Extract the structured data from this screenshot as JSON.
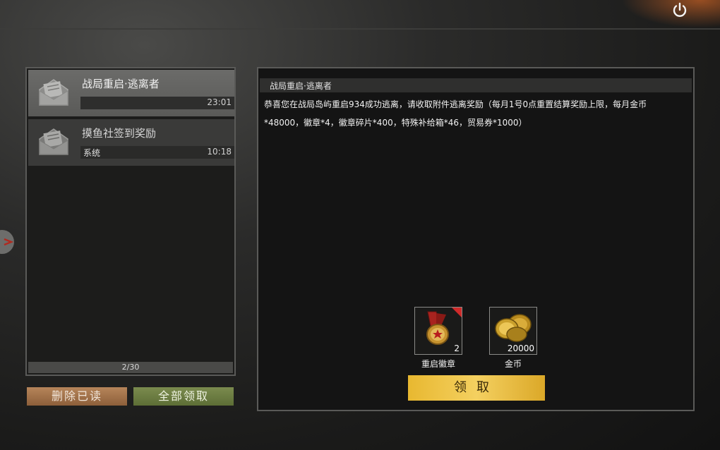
{
  "mail_list": {
    "items": [
      {
        "title": "战局重启·逃离者",
        "sender": "",
        "time": "23:01",
        "selected": true
      },
      {
        "title": "摸鱼社签到奖励",
        "sender": "系统",
        "time": "10:18",
        "selected": false
      }
    ],
    "pager": "2/30"
  },
  "buttons": {
    "delete_read": "删除已读",
    "claim_all": "全部领取",
    "claim": "领取"
  },
  "detail": {
    "title": "战局重启·逃离者",
    "body_line1": "恭喜您在战局岛屿重启934成功逃离，请收取附件逃离奖励（每月1号0点重置结算奖励上限，每月金币",
    "body_line2": "*48000，徽章*4，徽章碎片*400，特殊补给箱*46，贸易券*1000）",
    "attachments": [
      {
        "name": "重启徽章",
        "count": "2",
        "icon": "medal-icon"
      },
      {
        "name": "金币",
        "count": "20000",
        "icon": "gold-coin-icon"
      }
    ]
  },
  "colors": {
    "claim_button": "#f4d060",
    "delete_button": "#a6764c",
    "claim_all_button": "#6e7e44"
  }
}
